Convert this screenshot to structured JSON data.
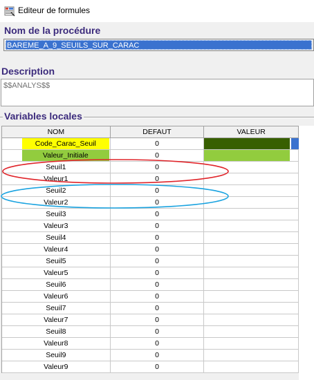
{
  "window": {
    "title": "Editeur de formules",
    "icon": "formula-editor-icon"
  },
  "procedure": {
    "label": "Nom de la procédure",
    "value": "BAREME_A_9_SEUILS_SUR_CARAC"
  },
  "description": {
    "label": "Description",
    "value": "$$ANALYS$$"
  },
  "variables": {
    "label": "Variables locales",
    "columns": [
      "NOM",
      "DEFAUT",
      "VALEUR"
    ],
    "rows": [
      {
        "nom": "Code_Carac_Seuil",
        "defaut": "0",
        "valeur": ""
      },
      {
        "nom": "Valeur_Initiale",
        "defaut": "0",
        "valeur": ""
      },
      {
        "nom": "Seuil1",
        "defaut": "0",
        "valeur": ""
      },
      {
        "nom": "Valeur1",
        "defaut": "0",
        "valeur": ""
      },
      {
        "nom": "Seuil2",
        "defaut": "0",
        "valeur": ""
      },
      {
        "nom": "Valeur2",
        "defaut": "0",
        "valeur": ""
      },
      {
        "nom": "Seuil3",
        "defaut": "0",
        "valeur": ""
      },
      {
        "nom": "Valeur3",
        "defaut": "0",
        "valeur": ""
      },
      {
        "nom": "Seuil4",
        "defaut": "0",
        "valeur": ""
      },
      {
        "nom": "Valeur4",
        "defaut": "0",
        "valeur": ""
      },
      {
        "nom": "Seuil5",
        "defaut": "0",
        "valeur": ""
      },
      {
        "nom": "Valeur5",
        "defaut": "0",
        "valeur": ""
      },
      {
        "nom": "Seuil6",
        "defaut": "0",
        "valeur": ""
      },
      {
        "nom": "Valeur6",
        "defaut": "0",
        "valeur": ""
      },
      {
        "nom": "Seuil7",
        "defaut": "0",
        "valeur": ""
      },
      {
        "nom": "Valeur7",
        "defaut": "0",
        "valeur": ""
      },
      {
        "nom": "Seuil8",
        "defaut": "0",
        "valeur": ""
      },
      {
        "nom": "Valeur8",
        "defaut": "0",
        "valeur": ""
      },
      {
        "nom": "Seuil9",
        "defaut": "0",
        "valeur": ""
      },
      {
        "nom": "Valeur9",
        "defaut": "0",
        "valeur": ""
      }
    ]
  },
  "colors": {
    "section_label": "#3b2a7c",
    "selection": "#3a72cf",
    "yellow_highlight": "#ffff00",
    "green_highlight": "#92cc3e",
    "dark_green_value": "#375f00",
    "annotation_red": "#e0242a",
    "annotation_blue": "#1aa3e0"
  }
}
